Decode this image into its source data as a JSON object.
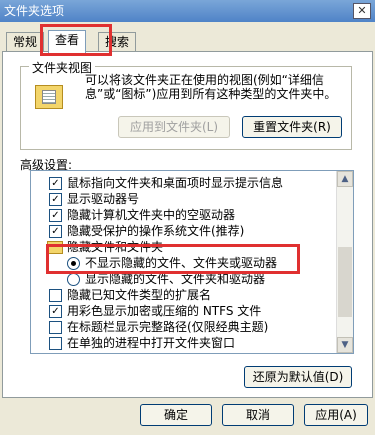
{
  "window": {
    "title": "文件夹选项",
    "close_glyph": "✕"
  },
  "tabs": [
    {
      "label": "常规"
    },
    {
      "label": "查看",
      "active": true
    },
    {
      "label": "搜索"
    }
  ],
  "folder_views": {
    "legend": "文件夹视图",
    "description": "可以将该文件夹正在使用的视图(例如“详细信息”或“图标”)应用到所有这种类型的文件夹中。",
    "apply_button": "应用到文件夹(L)",
    "reset_button": "重置文件夹(R)"
  },
  "advanced": {
    "label": "高级设置:",
    "items": [
      {
        "kind": "checkbox",
        "checked": true,
        "label": "鼠标指向文件夹和桌面项时显示提示信息"
      },
      {
        "kind": "checkbox",
        "checked": true,
        "label": "显示驱动器号"
      },
      {
        "kind": "checkbox",
        "checked": true,
        "label": "隐藏计算机文件夹中的空驱动器"
      },
      {
        "kind": "checkbox",
        "checked": true,
        "label": "隐藏受保护的操作系统文件(推荐)"
      },
      {
        "kind": "folder",
        "label": "隐藏文件和文件夹"
      },
      {
        "kind": "radio",
        "checked": true,
        "label": "不显示隐藏的文件、文件夹或驱动器"
      },
      {
        "kind": "radio",
        "checked": false,
        "label": "显示隐藏的文件、文件夹和驱动器"
      },
      {
        "kind": "checkbox",
        "checked": false,
        "label": "隐藏已知文件类型的扩展名"
      },
      {
        "kind": "checkbox",
        "checked": true,
        "label": "用彩色显示加密或压缩的 NTFS 文件"
      },
      {
        "kind": "checkbox",
        "checked": false,
        "label": "在标题栏显示完整路径(仅限经典主题)"
      },
      {
        "kind": "checkbox",
        "checked": false,
        "label": "在单独的进程中打开文件夹窗口"
      }
    ],
    "restore_button": "还原为默认值(D)"
  },
  "footer": {
    "ok": "确定",
    "cancel": "取消",
    "apply": "应用(A)"
  },
  "accent_color": "#e03030"
}
